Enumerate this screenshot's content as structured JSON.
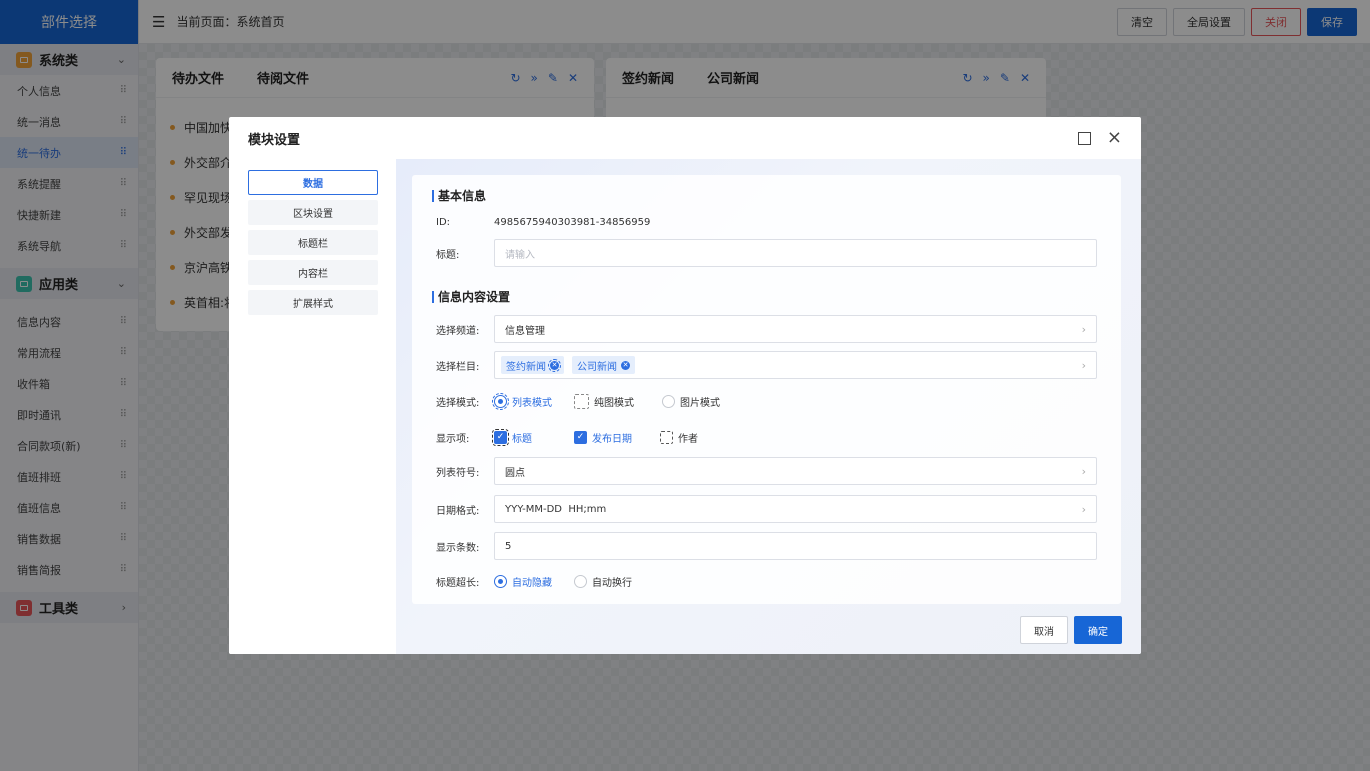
{
  "sidebar": {
    "title": "部件选择",
    "categories": [
      {
        "label": "系统类",
        "icon": "system-icon",
        "color": "#f0a23a",
        "chevron": "⌄",
        "items": [
          "个人信息",
          "统一消息",
          "统一待办",
          "系统提醒",
          "快捷新建",
          "系统导航"
        ]
      },
      {
        "label": "应用类",
        "icon": "app-icon",
        "color": "#3cc4b0",
        "chevron": "⌄",
        "items": [
          "信息内容",
          "常用流程",
          "收件箱",
          "即时通讯",
          "合同款项(新)",
          "值班排班",
          "值班信息",
          "销售数据",
          "销售简报"
        ]
      },
      {
        "label": "工具类",
        "icon": "tool-icon",
        "color": "#e8565a",
        "chevron": "›",
        "items": []
      }
    ],
    "active_item": "统一待办"
  },
  "topbar": {
    "breadcrumb": "当前页面：系统首页",
    "buttons": {
      "clear": "清空",
      "global": "全局设置",
      "close": "关闭",
      "save": "保存"
    }
  },
  "cards": {
    "left": {
      "tabs": [
        "待办文件",
        "待阅文件"
      ],
      "rows": [
        "中国加快",
        "外交部介",
        "罕见现场",
        "外交部发",
        "京沪高铁",
        "英首相:将"
      ]
    },
    "right": {
      "tabs": [
        "签约新闻",
        "公司新闻"
      ]
    }
  },
  "modal": {
    "title": "模块设置",
    "menu": [
      "数据",
      "区块设置",
      "标题栏",
      "内容栏",
      "扩展样式"
    ],
    "active_menu": "数据",
    "basic": {
      "section": "基本信息",
      "id_label": "ID:",
      "id_value": "4985675940303981-34856959",
      "title_label": "标题:",
      "title_placeholder": "请输入"
    },
    "content": {
      "section": "信息内容设置",
      "channel_label": "选择频道:",
      "channel_value": "信息管理",
      "column_label": "选择栏目:",
      "column_tags": [
        "签约新闻",
        "公司新闻"
      ],
      "mode_label": "选择模式:",
      "mode_options": [
        "列表模式",
        "纯图模式",
        "图片模式"
      ],
      "display_label": "显示项:",
      "display_options": [
        "标题",
        "发布日期",
        "作者"
      ],
      "symbol_label": "列表符号:",
      "symbol_value": "圆点",
      "date_label": "日期格式:",
      "date_value": "YYY-MM-DD  HH;mm",
      "count_label": "显示条数:",
      "count_value": "5",
      "overflow_label": "标题超长:",
      "overflow_options": [
        "自动隐藏",
        "自动换行"
      ]
    },
    "footer": {
      "cancel": "取消",
      "ok": "确定"
    }
  }
}
